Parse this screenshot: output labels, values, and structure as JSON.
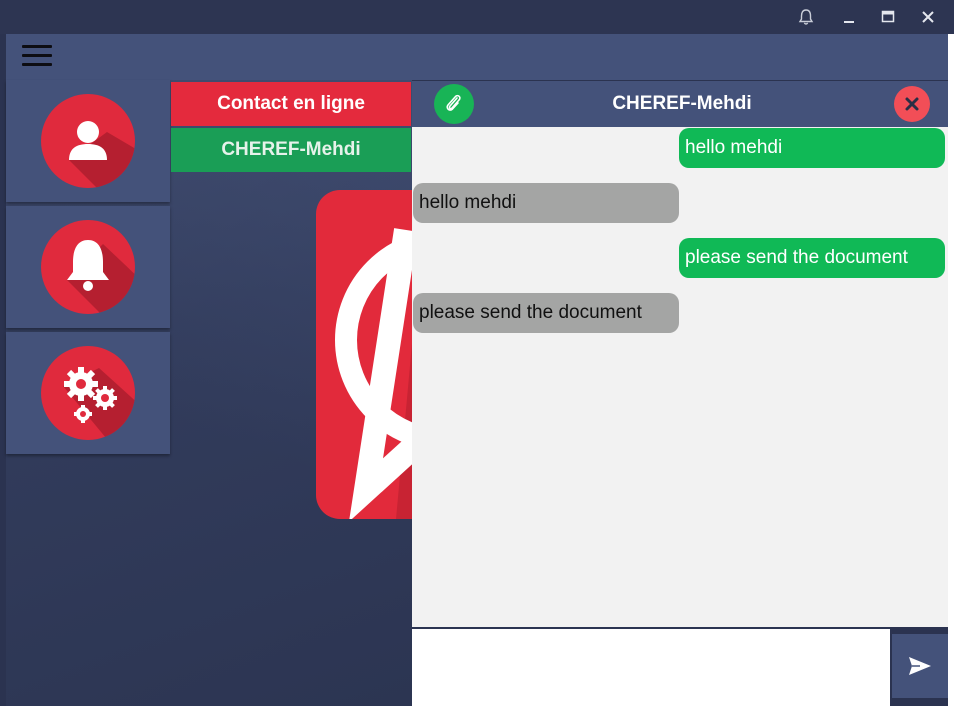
{
  "window": {
    "buttons": [
      "bell-icon",
      "minimize-icon",
      "maximize-icon",
      "close-icon"
    ]
  },
  "appbar": {
    "menu_icon": "hamburger-menu-icon"
  },
  "sidebar": {
    "items": [
      {
        "icon": "user-icon",
        "color": "#e02a3d"
      },
      {
        "icon": "bell-icon",
        "color": "#e02a3d"
      },
      {
        "icon": "gears-icon",
        "color": "#e02a3d"
      }
    ]
  },
  "contacts": {
    "header": "Contact en ligne",
    "header_color": "#e42a3d",
    "items": [
      {
        "name": "CHEREF-Mehdi",
        "color": "#1a9e56"
      }
    ]
  },
  "chat": {
    "title": "CHEREF-Mehdi",
    "attach_icon": "paperclip-icon",
    "close_icon": "close-icon",
    "messages": [
      {
        "text": "hello mehdi",
        "direction": "out"
      },
      {
        "text": "hello mehdi",
        "direction": "in"
      },
      {
        "text": "please send the document",
        "direction": "out"
      },
      {
        "text": "please send the document",
        "direction": "in"
      }
    ],
    "input_value": "",
    "send_icon": "send-icon",
    "out_color": "#10b956",
    "in_color": "#a4a5a4"
  }
}
